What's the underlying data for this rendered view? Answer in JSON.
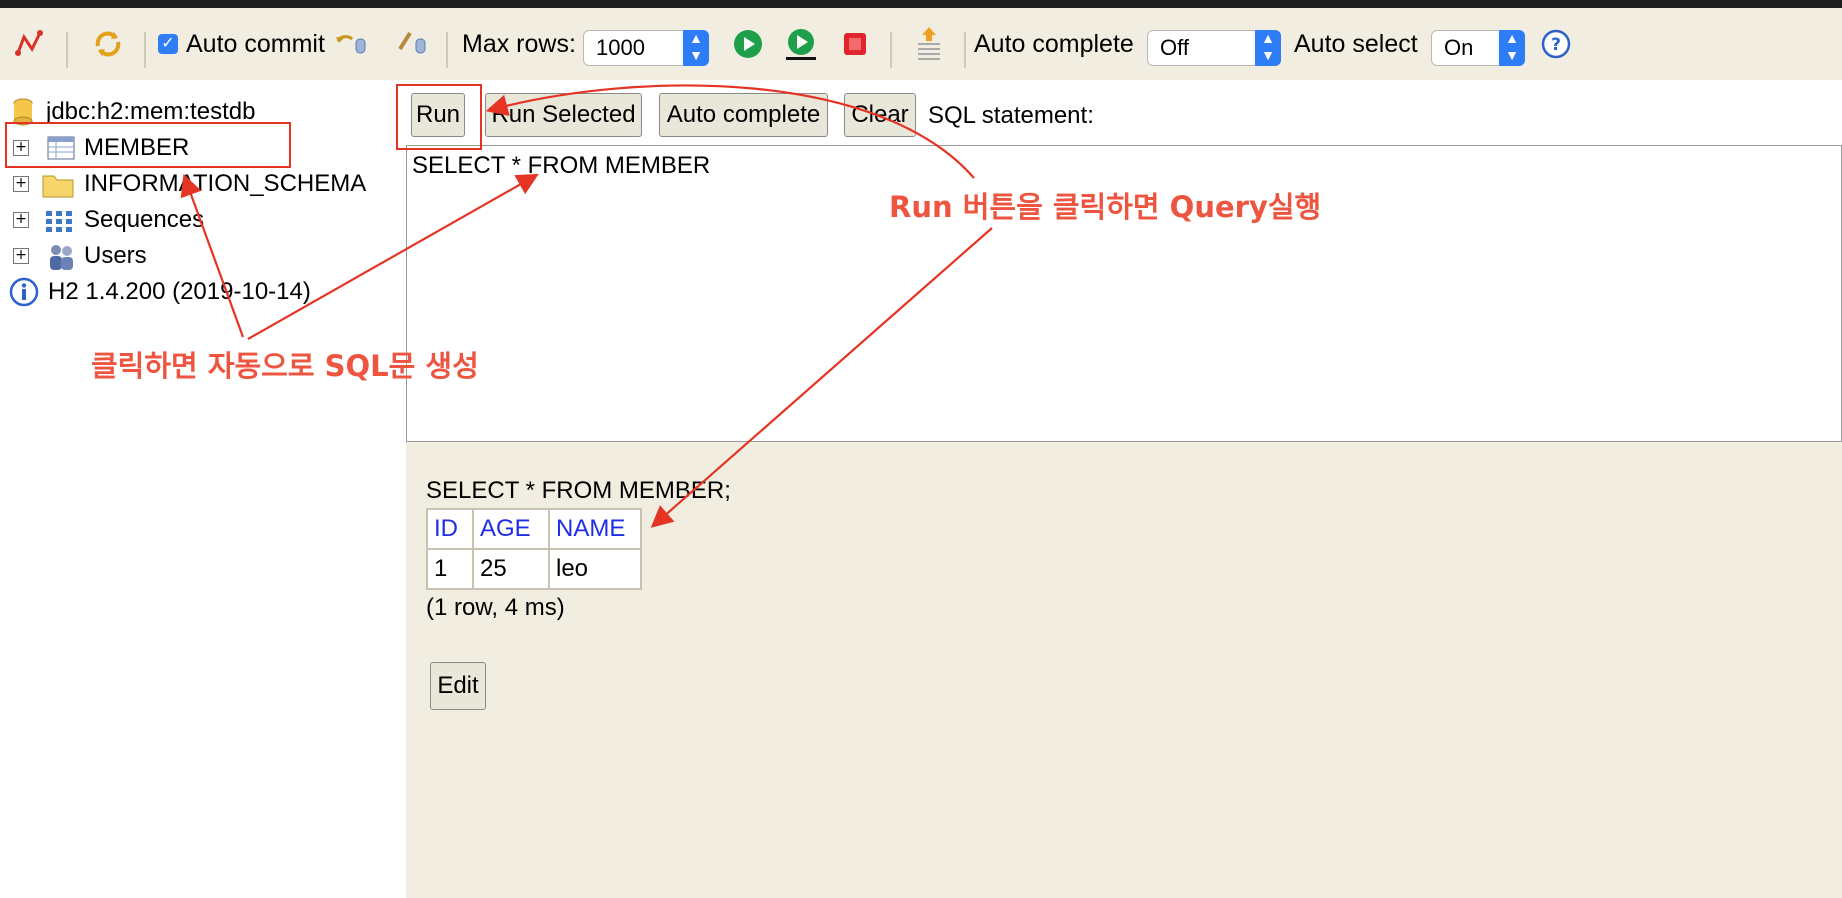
{
  "toolbar": {
    "auto_commit_label": "Auto commit",
    "auto_commit_checked": true,
    "max_rows_label": "Max rows:",
    "max_rows_value": "1000",
    "auto_complete_label": "Auto complete",
    "auto_complete_value": "Off",
    "auto_select_label": "Auto select",
    "auto_select_value": "On",
    "icons": [
      "disconnect-icon",
      "refresh-icon",
      "rollback-icon",
      "commit-icon",
      "run-icon",
      "run-selected-icon",
      "stop-icon",
      "history-icon",
      "help-icon"
    ],
    "colors": {
      "run_green": "#1ea04a",
      "stop_red": "#e0262c",
      "select_blue": "#2f7df6"
    }
  },
  "tree": {
    "connection": "jdbc:h2:mem:testdb",
    "items": [
      {
        "label": "MEMBER",
        "icon": "table-icon"
      },
      {
        "label": "INFORMATION_SCHEMA",
        "icon": "folder-icon"
      },
      {
        "label": "Sequences",
        "icon": "sequences-icon"
      },
      {
        "label": "Users",
        "icon": "users-icon"
      }
    ],
    "version": "H2 1.4.200 (2019-10-14)"
  },
  "buttons": {
    "run": "Run",
    "run_selected": "Run Selected",
    "auto_complete": "Auto complete",
    "clear": "Clear",
    "sql_statement_label": "SQL statement:"
  },
  "editor": {
    "sql": "SELECT * FROM MEMBER"
  },
  "result": {
    "statement": "SELECT * FROM MEMBER;",
    "columns": [
      "ID",
      "AGE",
      "NAME"
    ],
    "rows": [
      [
        "1",
        "25",
        "leo"
      ]
    ],
    "summary": "(1 row, 4 ms)",
    "edit_label": "Edit"
  },
  "annotations": {
    "run_note": "Run 버튼을 클릭하면 Query실행",
    "click_note": "클릭하면 자동으로 SQL문 생성",
    "color": "#ee5540"
  }
}
